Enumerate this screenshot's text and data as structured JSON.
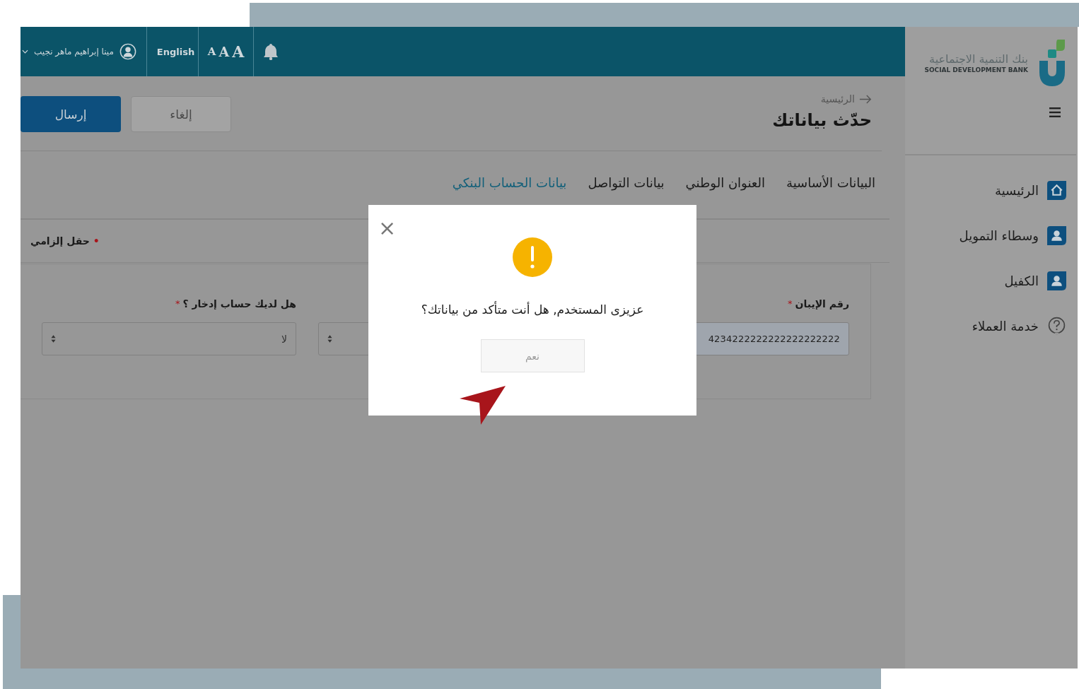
{
  "header": {
    "user_name": "مينا إبراهيم ماهر نجيب",
    "language_link": "English",
    "font_sizes": [
      "A",
      "A",
      "A"
    ]
  },
  "sidebar": {
    "logo": {
      "name_ar": "بنك التنمية الاجتماعية",
      "name_en": "SOCIAL DEVELOPMENT BANK"
    },
    "items": [
      {
        "label": "الرئيسية"
      },
      {
        "label": "وسطاء التمويل"
      },
      {
        "label": "الكفيل"
      },
      {
        "label": "خدمة العملاء"
      }
    ]
  },
  "breadcrumb": "الرئيسية",
  "page_title": "حدّث بياناتك",
  "actions": {
    "submit": "إرسال",
    "cancel": "إلغاء"
  },
  "tabs": [
    {
      "label": "البيانات الأساسية",
      "selected": false
    },
    {
      "label": "العنوان الوطني",
      "selected": false
    },
    {
      "label": "بيانات التواصل",
      "selected": false
    },
    {
      "label": "بيانات الحساب البنكي",
      "selected": true
    }
  ],
  "required_note": {
    "bullet": "•",
    "text": "حقل إلزامي"
  },
  "form": {
    "fields": [
      {
        "kind": "text",
        "label": "رقم الإيبان",
        "required": true,
        "required_mark": "*",
        "value": "4234222222222222222222"
      },
      {
        "kind": "select"
      },
      {
        "kind": "select",
        "label": "هل لديك حساب إدخار ؟",
        "required": true,
        "required_mark": "*",
        "value": "لا"
      }
    ]
  },
  "dialog": {
    "close": "×",
    "message": "عزيزى المستخدم, هل أنت متأكد من بياناتك؟",
    "confirm_button": "نعم",
    "confirm_disabled": true
  }
}
